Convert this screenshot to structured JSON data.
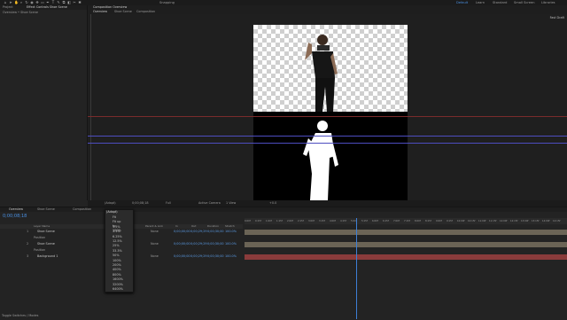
{
  "colors": {
    "accent": "#4a8fe0",
    "bg": "#232323",
    "guide_red": "#7a2b2b",
    "guide_blue": "#4d4dc0",
    "playhead": "#3d7fd6",
    "track_tan": "#6b6456",
    "track_red": "#8a3b3b"
  },
  "topbar": {
    "tools": [
      "home-icon",
      "arrow-icon",
      "hand-icon",
      "zoom-icon",
      "rotate-icon",
      "camera-icon",
      "pan-icon",
      "rect-icon",
      "pen-icon",
      "text-icon",
      "brush-icon",
      "clone-icon",
      "eraser-icon",
      "roto-icon",
      "pin-icon"
    ],
    "snapping": "Snapping",
    "workspaces": [
      "Default",
      "Learn",
      "Standard",
      "Small Screen",
      "Libraries"
    ],
    "active_workspace": "Default"
  },
  "project": {
    "tabs": [
      "Project",
      "Effect Controls Shoe Scene"
    ],
    "breadcrumb": "Overview • Shoe Scene"
  },
  "composition": {
    "tab": "Composition Overview",
    "subtabs": [
      "Overview",
      "Shoe Scene",
      "Composition"
    ],
    "renderer": "Fast Draft"
  },
  "viewer_footer": {
    "zoom": "(Adapt)",
    "timecode": "0;00;08;18",
    "quality": "Full",
    "camera": "Active Camera",
    "views": "1 View",
    "offset": "+0.0"
  },
  "timeline": {
    "tabs": [
      "Overview",
      "Shoe Scene",
      "Composition"
    ],
    "timecode": "0;00;08;18",
    "columns": [
      "Layer Name",
      "Parent & Link",
      "In",
      "Out",
      "Duration",
      "Stretch"
    ],
    "layers": [
      {
        "num": "1",
        "name": "Shoe Scene",
        "parent": "None",
        "in": "0;00;00;00",
        "out": "0;00;29;29",
        "dur": "0;00;30;00",
        "stretch": "100.0%",
        "sub": "Position"
      },
      {
        "num": "2",
        "name": "Shoe Scene",
        "parent": "None",
        "in": "0;00;00;00",
        "out": "0;00;29;29",
        "dur": "0;00;30;00",
        "stretch": "100.0%",
        "sub": "Position"
      },
      {
        "num": "3",
        "name": "Background 1",
        "parent": "None",
        "in": "0;00;00;00",
        "out": "0;00;29;29",
        "dur": "0;00;30;00",
        "stretch": "100.0%",
        "sub": ""
      }
    ],
    "footer": "Toggle Switches / Modes",
    "ruler": [
      "0:00f",
      "0:15f",
      "1:00f",
      "1:15f",
      "2:00f",
      "2:15f",
      "3:00f",
      "3:15f",
      "4:00f",
      "4:15f",
      "5:00f",
      "5:15f",
      "6:00f",
      "6:15f",
      "7:00f",
      "7:15f",
      "8:00f",
      "8:15f",
      "9:00f",
      "9:15f",
      "10:00f",
      "10:15f",
      "11:00f",
      "11:15f",
      "12:00f",
      "12:15f",
      "13:00f",
      "13:15f",
      "14:00f",
      "14:15f"
    ]
  },
  "zoom_menu": {
    "items": [
      "Fit",
      "Fit up to 100%",
      "1.5%",
      "3.1%",
      "6.25%",
      "12.5%",
      "25%",
      "33.3%",
      "50%",
      "100%",
      "200%",
      "400%",
      "800%",
      "1600%",
      "3200%",
      "6400%"
    ],
    "checked": "(Adapt)"
  }
}
